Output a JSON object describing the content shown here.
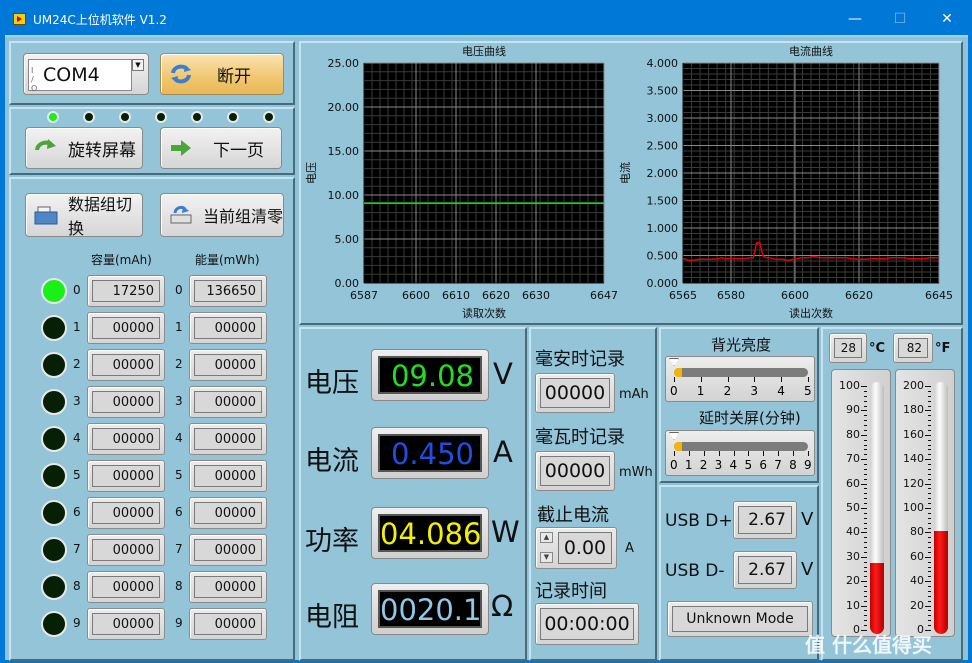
{
  "window": {
    "title": "UM24C上位机软件 V1.2",
    "controls": {
      "minimize": "—",
      "maximize": "☐",
      "close": "✕"
    }
  },
  "connection": {
    "port_prefix": "I/O",
    "port_value": "COM4",
    "disconnect_label": "断开"
  },
  "screen_indicators": [
    true,
    false,
    false,
    false,
    false,
    false,
    false
  ],
  "nav": {
    "rotate_label": "旋转屏幕",
    "next_page_label": "下一页"
  },
  "groups": {
    "switch_label": "数据组切换",
    "clear_label": "当前组清零",
    "capacity_header": "容量(mAh)",
    "energy_header": "能量(mWh)",
    "rows": [
      {
        "index": "0",
        "active": true,
        "capacity": "17250",
        "energy": "136650"
      },
      {
        "index": "1",
        "active": false,
        "capacity": "00000",
        "energy": "00000"
      },
      {
        "index": "2",
        "active": false,
        "capacity": "00000",
        "energy": "00000"
      },
      {
        "index": "3",
        "active": false,
        "capacity": "00000",
        "energy": "00000"
      },
      {
        "index": "4",
        "active": false,
        "capacity": "00000",
        "energy": "00000"
      },
      {
        "index": "5",
        "active": false,
        "capacity": "00000",
        "energy": "00000"
      },
      {
        "index": "6",
        "active": false,
        "capacity": "00000",
        "energy": "00000"
      },
      {
        "index": "7",
        "active": false,
        "capacity": "00000",
        "energy": "00000"
      },
      {
        "index": "8",
        "active": false,
        "capacity": "00000",
        "energy": "00000"
      },
      {
        "index": "9",
        "active": false,
        "capacity": "00000",
        "energy": "00000"
      }
    ]
  },
  "chart_data": [
    {
      "type": "line",
      "title": "电压曲线",
      "xlabel": "读取次数",
      "ylabel": "电压",
      "xlim": [
        6587,
        6647
      ],
      "ylim": [
        0,
        25
      ],
      "xticks": [
        "6587",
        "6600",
        "6610",
        "6620",
        "6630",
        "6647"
      ],
      "xtick_values": [
        6587,
        6600,
        6610,
        6620,
        6630,
        6647
      ],
      "yticks": [
        "0.00",
        "5.00",
        "10.00",
        "15.00",
        "20.00",
        "25.00"
      ],
      "ytick_values": [
        0,
        5,
        10,
        15,
        20,
        25
      ],
      "grid": true,
      "line_color": "#22dd22",
      "series": [
        {
          "name": "电压",
          "x": [
            6587,
            6647
          ],
          "y": [
            9.08,
            9.08
          ]
        }
      ]
    },
    {
      "type": "line",
      "title": "电流曲线",
      "xlabel": "读出次数",
      "ylabel": "电流",
      "xlim": [
        6565,
        6645
      ],
      "ylim": [
        0,
        4
      ],
      "xticks": [
        "6565",
        "6580",
        "6600",
        "6620",
        "6645"
      ],
      "xtick_values": [
        6565,
        6580,
        6600,
        6620,
        6645
      ],
      "yticks": [
        "0.000",
        "0.500",
        "1.000",
        "1.500",
        "2.000",
        "2.500",
        "3.000",
        "3.500",
        "4.000"
      ],
      "ytick_values": [
        0,
        0.5,
        1,
        1.5,
        2,
        2.5,
        3,
        3.5,
        4
      ],
      "grid": true,
      "line_color": "#e00000",
      "series": [
        {
          "name": "电流",
          "x": [
            6565,
            6566,
            6567,
            6568,
            6570,
            6572,
            6574,
            6576,
            6577,
            6578,
            6580,
            6582,
            6584,
            6586,
            6587,
            6588,
            6589,
            6590,
            6591,
            6592,
            6594,
            6596,
            6598,
            6600,
            6602,
            6604,
            6606,
            6608,
            6610,
            6612,
            6614,
            6616,
            6618,
            6620,
            6622,
            6624,
            6626,
            6628,
            6630,
            6632,
            6634,
            6636,
            6638,
            6640,
            6642,
            6645
          ],
          "y": [
            0.44,
            0.43,
            0.41,
            0.41,
            0.43,
            0.43,
            0.43,
            0.44,
            0.46,
            0.44,
            0.44,
            0.44,
            0.44,
            0.46,
            0.46,
            0.73,
            0.73,
            0.49,
            0.46,
            0.46,
            0.43,
            0.43,
            0.41,
            0.44,
            0.46,
            0.46,
            0.48,
            0.46,
            0.46,
            0.46,
            0.46,
            0.46,
            0.44,
            0.43,
            0.43,
            0.44,
            0.44,
            0.44,
            0.46,
            0.46,
            0.46,
            0.44,
            0.44,
            0.44,
            0.46,
            0.46
          ]
        }
      ]
    }
  ],
  "readings": {
    "voltage": {
      "label": "电压",
      "value": "09.08",
      "unit": "V",
      "color": "#22dd22"
    },
    "current": {
      "label": "电流",
      "value": "0.450",
      "unit": "A",
      "color": "#1e4fe0"
    },
    "power": {
      "label": "功率",
      "value": "04.086",
      "unit": "W",
      "color": "#f5f000"
    },
    "resistance": {
      "label": "电阻",
      "value": "0020.1",
      "unit": "Ω",
      "color": "#8fc7e8"
    }
  },
  "records": {
    "mah_label": "毫安时记录",
    "mah_value": "00000",
    "mah_unit": "mAh",
    "mwh_label": "毫瓦时记录",
    "mwh_value": "00000",
    "mwh_unit": "mWh",
    "cutoff_label": "截止电流",
    "cutoff_value": "0.00",
    "cutoff_unit": "A",
    "time_label": "记录时间",
    "time_value": "00:00:00"
  },
  "display_settings": {
    "brightness_label": "背光亮度",
    "brightness_value": 0,
    "brightness_ticks": [
      "0",
      "1",
      "2",
      "3",
      "4",
      "5"
    ],
    "timeout_label": "延时关屏(分钟)",
    "timeout_value": 0,
    "timeout_ticks": [
      "0",
      "1",
      "2",
      "3",
      "4",
      "5",
      "6",
      "7",
      "8",
      "9"
    ]
  },
  "usb": {
    "dplus_label": "USB D+",
    "dplus_value": "2.67",
    "dplus_unit": "V",
    "dminus_label": "USB D-",
    "dminus_value": "2.67",
    "dminus_unit": "V",
    "mode_label": "Unknown Mode"
  },
  "temperature": {
    "celsius_value": "28",
    "celsius_unit": "°C",
    "fahrenheit_value": "82",
    "fahrenheit_unit": "°F",
    "celsius_fill": 28,
    "celsius_max": 100,
    "fahrenheit_fill": 82,
    "fahrenheit_max": 200,
    "celsius_scale": [
      "100",
      "90",
      "80",
      "70",
      "60",
      "50",
      "40",
      "30",
      "20",
      "10",
      "0"
    ],
    "fahrenheit_scale": [
      "200",
      "180",
      "160",
      "140",
      "120",
      "100",
      "80",
      "60",
      "40",
      "20",
      "0"
    ]
  },
  "watermark": "值 什么值得买"
}
